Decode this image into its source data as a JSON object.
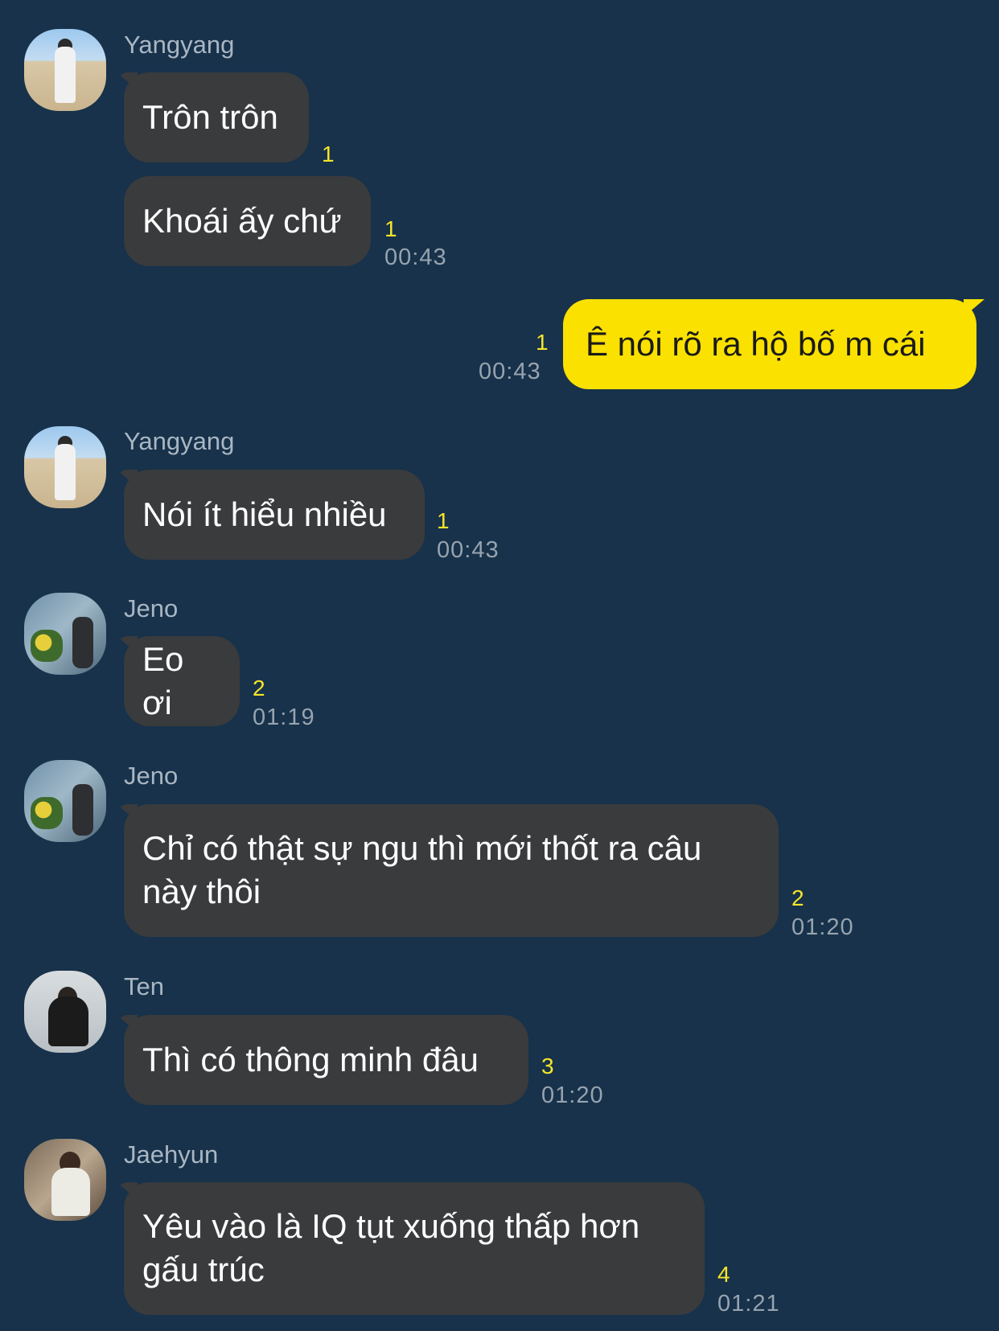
{
  "messages": [
    {
      "sender": "Yangyang",
      "text": "Trôn trôn",
      "unread": "1"
    },
    {
      "sender": "Yangyang",
      "text": "Khoái ấy chứ",
      "unread": "1",
      "time": "00:43"
    },
    {
      "sender": "me",
      "text": "Ê nói rõ ra hộ bố m cái",
      "unread": "1",
      "time": "00:43"
    },
    {
      "sender": "Yangyang",
      "text": "Nói ít hiểu nhiều",
      "unread": "1",
      "time": "00:43"
    },
    {
      "sender": "Jeno",
      "text": "Eo ơi",
      "unread": "2",
      "time": "01:19"
    },
    {
      "sender": "Jeno",
      "text_lines": [
        "Chỉ có thật sự ngu thì mới thốt ra câu",
        "này thôi"
      ],
      "unread": "2",
      "time": "01:20"
    },
    {
      "sender": "Ten",
      "text": "Thì có thông minh đâu",
      "unread": "3",
      "time": "01:20"
    },
    {
      "sender": "Jaehyun",
      "text_lines": [
        "Yêu vào là IQ tụt xuống thấp hơn",
        "gấu trúc"
      ],
      "unread": "4",
      "time": "01:21"
    }
  ],
  "colors": {
    "background": "#17324a",
    "bubble_other": "#3a3b3d",
    "bubble_mine": "#fae100",
    "unread_count": "#f5e52a"
  }
}
